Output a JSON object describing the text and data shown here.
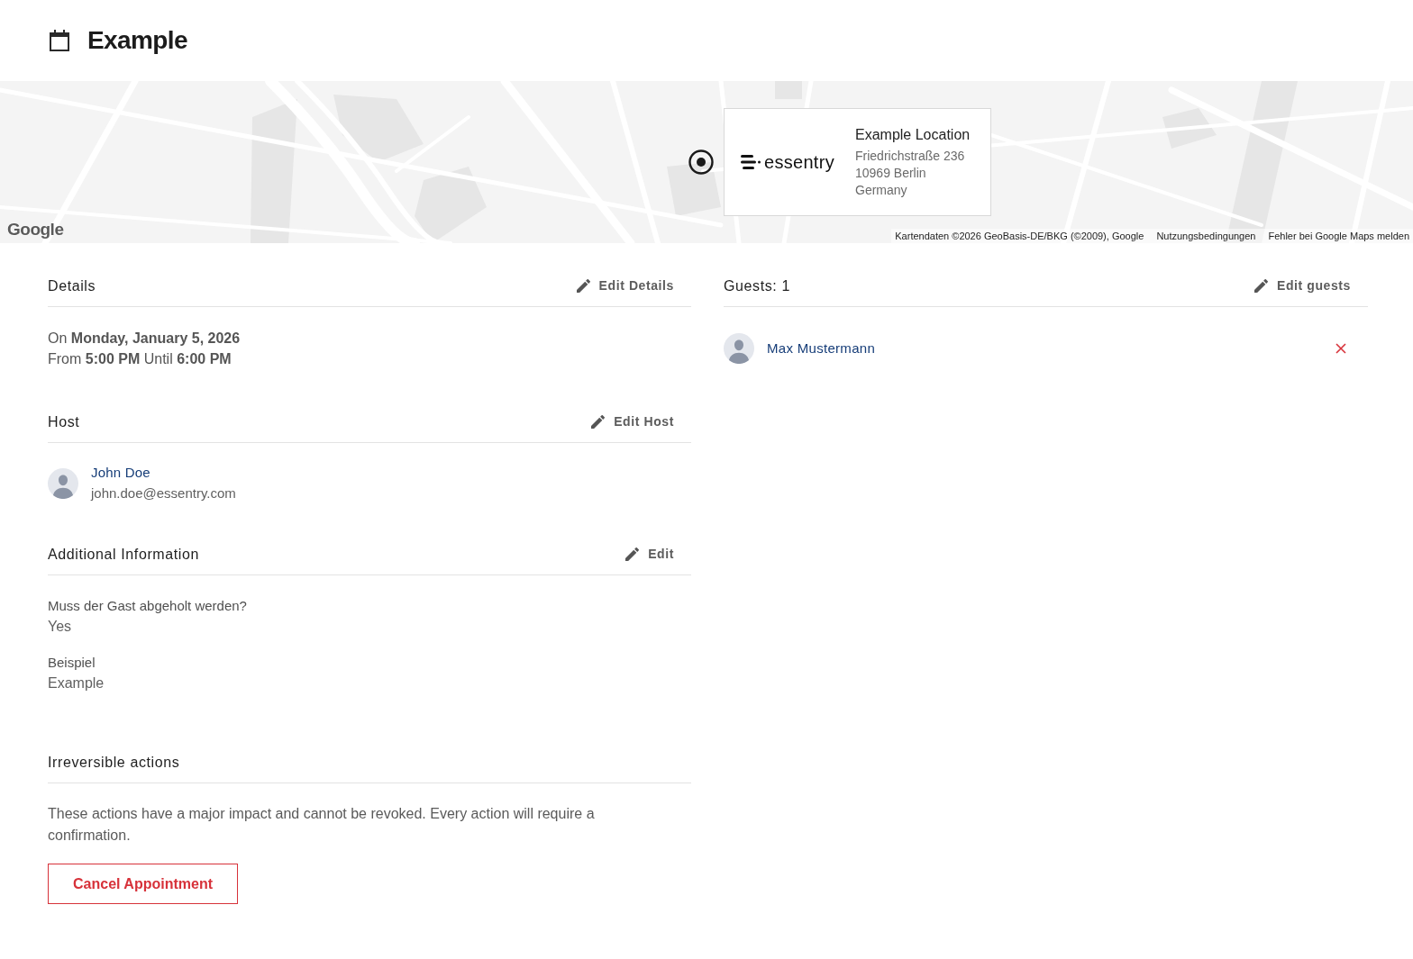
{
  "header": {
    "title": "Example"
  },
  "map": {
    "logo": "Google",
    "location_card": {
      "brand": "essentry",
      "name": "Example Location",
      "address_lines": [
        "Friedrichstraße 236",
        "10969 Berlin",
        "Germany"
      ]
    },
    "attribution": [
      "Kartendaten ©2026 GeoBasis-DE/BKG (©2009), Google",
      "Nutzungsbedingungen",
      "Fehler bei Google Maps melden"
    ]
  },
  "left_sections": [
    {
      "kind": "details",
      "title": "Details",
      "edit_label": "Edit Details",
      "lines": [
        "On **Monday, January 5, 2026**",
        "From **5:00 PM** Until **6:00 PM**"
      ]
    },
    {
      "kind": "person",
      "title": "Host",
      "edit_label": "Edit Host",
      "person": {
        "name": "John Doe",
        "email": "john.doe@essentry.com"
      }
    },
    {
      "kind": "fields",
      "title": "Additional Information",
      "edit_label": "Edit",
      "fields": [
        {
          "label": "Muss der Gast abgeholt werden?",
          "value": "Yes"
        },
        {
          "label": "Beispiel",
          "value": "Example"
        }
      ]
    },
    {
      "kind": "danger",
      "title": "Irreversible actions",
      "text": "These actions have a major impact and cannot be revoked. Every action will require a confirmation.",
      "button": "Cancel Appointment"
    }
  ],
  "guests": {
    "title": "Guests: 1",
    "edit_label": "Edit guests",
    "items": [
      {
        "name": "Max Mustermann"
      }
    ]
  }
}
